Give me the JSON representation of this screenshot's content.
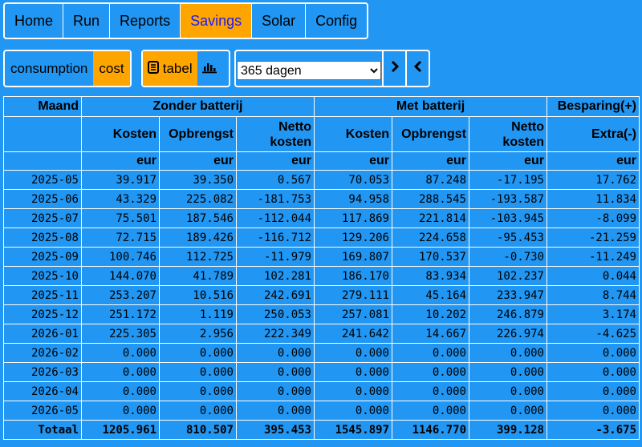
{
  "nav": [
    "Home",
    "Run",
    "Reports",
    "Savings",
    "Solar",
    "Config"
  ],
  "nav_active": "Savings",
  "toggle": {
    "consumption": "consumption",
    "cost": "cost"
  },
  "view": {
    "tabel": "tabel",
    "chart_icon": "bar-chart-icon",
    "table_icon": "list-icon"
  },
  "period": {
    "selected": "365 dagen",
    "next": "next-icon",
    "prev": "prev-icon"
  },
  "table": {
    "h_month": "Maand",
    "h_without": "Zonder batterij",
    "h_with": "Met batterij",
    "h_saving": "Besparing(+)",
    "h_extra": "Extra(-)",
    "h_cost": "Kosten",
    "h_yield": "Opbrengst",
    "h_net": "Netto kosten",
    "unit": "eur",
    "rows": [
      [
        "2025-05",
        "39.917",
        "39.350",
        "0.567",
        "70.053",
        "87.248",
        "-17.195",
        "17.762"
      ],
      [
        "2025-06",
        "43.329",
        "225.082",
        "-181.753",
        "94.958",
        "288.545",
        "-193.587",
        "11.834"
      ],
      [
        "2025-07",
        "75.501",
        "187.546",
        "-112.044",
        "117.869",
        "221.814",
        "-103.945",
        "-8.099"
      ],
      [
        "2025-08",
        "72.715",
        "189.426",
        "-116.712",
        "129.206",
        "224.658",
        "-95.453",
        "-21.259"
      ],
      [
        "2025-09",
        "100.746",
        "112.725",
        "-11.979",
        "169.807",
        "170.537",
        "-0.730",
        "-11.249"
      ],
      [
        "2025-10",
        "144.070",
        "41.789",
        "102.281",
        "186.170",
        "83.934",
        "102.237",
        "0.044"
      ],
      [
        "2025-11",
        "253.207",
        "10.516",
        "242.691",
        "279.111",
        "45.164",
        "233.947",
        "8.744"
      ],
      [
        "2025-12",
        "251.172",
        "1.119",
        "250.053",
        "257.081",
        "10.202",
        "246.879",
        "3.174"
      ],
      [
        "2026-01",
        "225.305",
        "2.956",
        "222.349",
        "241.642",
        "14.667",
        "226.974",
        "-4.625"
      ],
      [
        "2026-02",
        "0.000",
        "0.000",
        "0.000",
        "0.000",
        "0.000",
        "0.000",
        "0.000"
      ],
      [
        "2026-03",
        "0.000",
        "0.000",
        "0.000",
        "0.000",
        "0.000",
        "0.000",
        "0.000"
      ],
      [
        "2026-04",
        "0.000",
        "0.000",
        "0.000",
        "0.000",
        "0.000",
        "0.000",
        "0.000"
      ],
      [
        "2026-05",
        "0.000",
        "0.000",
        "0.000",
        "0.000",
        "0.000",
        "0.000",
        "0.000"
      ]
    ],
    "total": [
      "Totaal",
      "1205.961",
      "810.507",
      "395.453",
      "1545.897",
      "1146.770",
      "399.128",
      "-3.675"
    ]
  }
}
